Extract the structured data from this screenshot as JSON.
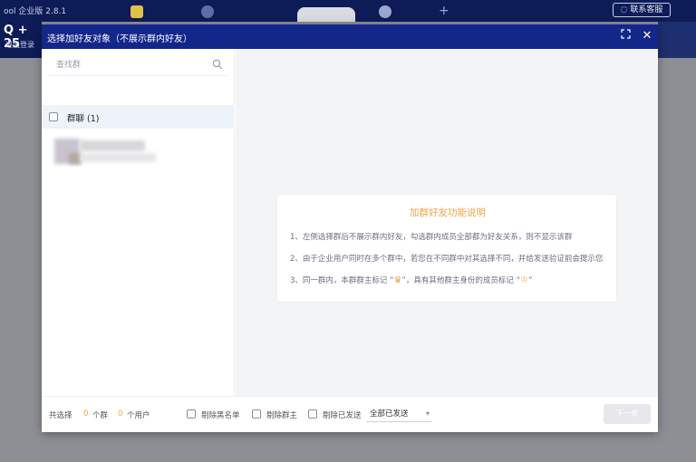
{
  "app": {
    "title": "ool 企业版 2.8.1",
    "brand": "Q + 25",
    "logout": "退出登录",
    "contact_label": "联系客服"
  },
  "modal": {
    "title": "选择加好友对象（不展示群内好友）",
    "search_placeholder": "查找群",
    "group_label": "群聊 (1)",
    "info": {
      "title": "加群好友功能说明",
      "lines": [
        "1、左侧选择群后不展示群内好友，勾选群内成员全部都为好友关系，则不显示该群",
        "2、由于企业用户同时在多个群中，若您在不同群中对其选择不同，并给发送验证前会提示您",
        "3、同一群内，本群群主标记 “",
        "”，具有其他群主身份的成员标记 “"
      ],
      "line3_end": "”"
    },
    "footer": {
      "selected_prefix": "共选择",
      "group_count": "0",
      "group_unit": "个群",
      "user_count": "0",
      "user_unit": "个用户",
      "opt1": "剔除黑名单",
      "opt2": "剔除群主",
      "opt3": "剔除已发送",
      "select_value": "全部已发送",
      "confirm_label": "下一步"
    }
  },
  "colors": {
    "header": "#13268a",
    "accent": "#f0a64a",
    "app_bar": "#0d1c57"
  },
  "icons": {
    "search": "search-icon",
    "fullscreen": "fullscreen-icon",
    "close": "close-icon",
    "crown": "crown-icon"
  }
}
